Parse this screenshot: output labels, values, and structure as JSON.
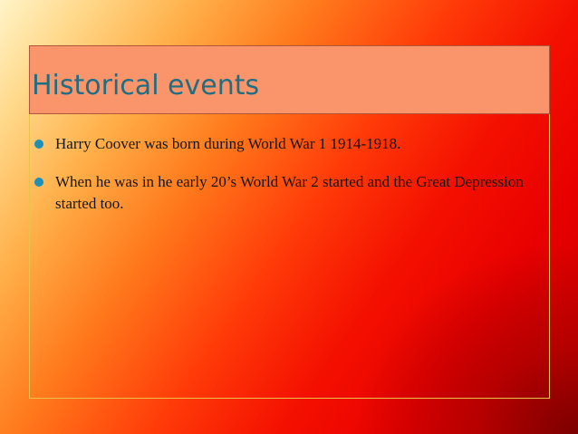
{
  "slide": {
    "title": "Historical events",
    "bullets": [
      "Harry Coover was born during World War 1 1914-1918.",
      "When he was in he early 20’s  World War 2 started and the Great Depression started too."
    ]
  },
  "colors": {
    "title_text": "#1e6e84",
    "title_box": "#f9946b",
    "bullet_marker": "#1e8fb6"
  }
}
